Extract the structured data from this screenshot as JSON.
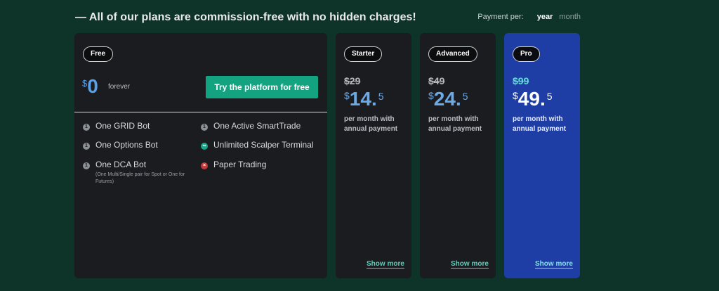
{
  "header": {
    "headline": "— All of our plans are commission-free with no hidden charges!",
    "payment_label": "Payment per:",
    "payment_options": [
      "year",
      "month"
    ],
    "payment_selected": "year"
  },
  "plans": {
    "free": {
      "badge": "Free",
      "currency": "$",
      "price": "0",
      "period": "forever",
      "cta": "Try the platform for free",
      "features": [
        {
          "icon": "count-1-icon",
          "marker": "1",
          "label": "One GRID Bot"
        },
        {
          "icon": "count-1-icon",
          "marker": "1",
          "label": "One Options Bot"
        },
        {
          "icon": "count-1-icon",
          "marker": "1",
          "label": "One DCA Bot",
          "note": "(One Multi/Single pair for Spot or One for Futures)"
        },
        {
          "icon": "count-1-icon",
          "marker": "1",
          "label": "One Active SmartTrade"
        },
        {
          "icon": "infinity-icon",
          "marker": "∞",
          "label": "Unlimited Scalper Terminal"
        },
        {
          "icon": "cross-icon",
          "marker": "×",
          "label": "Paper Trading"
        }
      ]
    },
    "starter": {
      "badge": "Starter",
      "old_price": "$29",
      "currency": "$",
      "price": "14.",
      "decimal": "5",
      "period": "per month with annual payment",
      "show_more": "Show more"
    },
    "advanced": {
      "badge": "Advanced",
      "old_price": "$49",
      "currency": "$",
      "price": "24.",
      "decimal": "5",
      "period": "per month with annual payment",
      "show_more": "Show more"
    },
    "pro": {
      "badge": "Pro",
      "old_price": "$99",
      "currency": "$",
      "price": "49.",
      "decimal": "5",
      "period": "per month with annual payment",
      "show_more": "Show more"
    }
  },
  "colors": {
    "background": "#0e3328",
    "card": "#1b1c1f",
    "pro_card": "#1e3ea5",
    "accent_green": "#13a381",
    "price_blue": "#5aa0e8",
    "link_teal": "#4fd6c0"
  }
}
